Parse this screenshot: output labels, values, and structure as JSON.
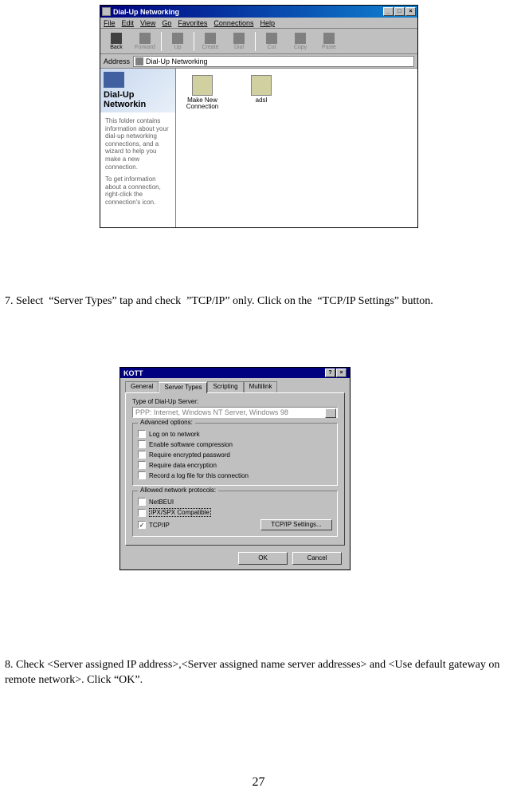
{
  "window1": {
    "title": "Dial-Up Networking",
    "menus": [
      "File",
      "Edit",
      "View",
      "Go",
      "Favorites",
      "Connections",
      "Help"
    ],
    "toolbar": {
      "back": "Back",
      "forward": "Forward",
      "up": "Up",
      "create": "Create",
      "dial": "Dial",
      "cut": "Cut",
      "copy": "Copy",
      "paste": "Paste"
    },
    "address_label": "Address",
    "address_value": "Dial-Up Networking",
    "sidebar": {
      "title": "Dial-Up Networkin",
      "desc1": "This folder contains information about your dial-up networking connections, and a wizard to help you make a new connection.",
      "desc2": "To get information about a connection, right-click the connection's icon."
    },
    "icons": {
      "make_new": "Make New Connection",
      "adsl": "adsl"
    }
  },
  "dialog2": {
    "title": "KOTT",
    "tabs": [
      "General",
      "Server Types",
      "Scripting",
      "Multilink"
    ],
    "server_type_label": "Type of Dial-Up Server:",
    "server_type_value": "PPP: Internet, Windows NT Server, Windows 98",
    "advanced_title": "Advanced options:",
    "adv_opts": {
      "log_on": "Log on to network",
      "software_comp": "Enable software compression",
      "enc_password": "Require encrypted password",
      "data_enc": "Require data encryption",
      "record_log": "Record a log file for this connection"
    },
    "protocols_title": "Allowed network protocols:",
    "protocols": {
      "netbeui": "NetBEUI",
      "ipx": "IPX/SPX Compatible",
      "tcpip": "TCP/IP"
    },
    "tcpip_settings": "TCP/IP Settings...",
    "ok": "OK",
    "cancel": "Cancel"
  },
  "instructions": {
    "step7": "7. Select  “Server Types” tap and check  ”TCP/IP” only. Click on the  “TCP/IP Settings” button.",
    "step8": "8. Check <Server assigned IP address>,<Server assigned name server addresses> and <Use default gateway on remote network>. Click “OK”."
  },
  "page_number": "27"
}
